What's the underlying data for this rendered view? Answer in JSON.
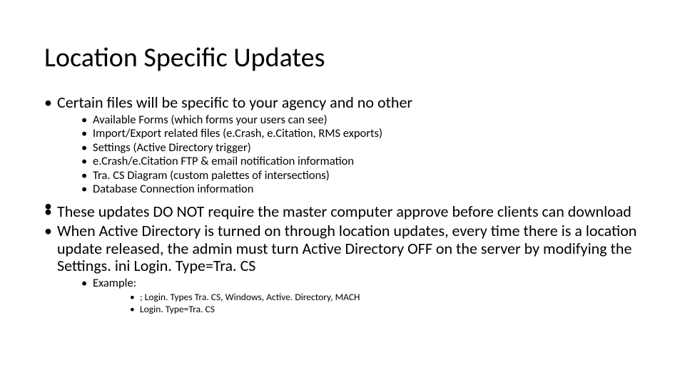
{
  "title": "Location Specific Updates",
  "bullets": {
    "b1": "Certain files will be specific to your agency and no other",
    "b1_sub": [
      "Available Forms (which forms your users can see)",
      "Import/Export related files (e.Crash, e.Citation, RMS exports)",
      "Settings (Active Directory trigger)",
      "e.Crash/e.Citation FTP & email notification information",
      "Tra. CS Diagram (custom palettes of intersections)",
      "Database Connection information"
    ],
    "b2": "These updates DO NOT require the master computer approve before clients can download",
    "b3": "When Active Directory is turned on through location updates, every time there is a location update released, the admin must turn Active Directory OFF on the server by modifying the Settings. ini Login. Type=Tra. CS",
    "b3_sub_label": "Example:",
    "b3_example": [
      "; Login. Types Tra. CS, Windows, Active. Directory, MACH",
      "Login. Type=Tra. CS"
    ]
  }
}
